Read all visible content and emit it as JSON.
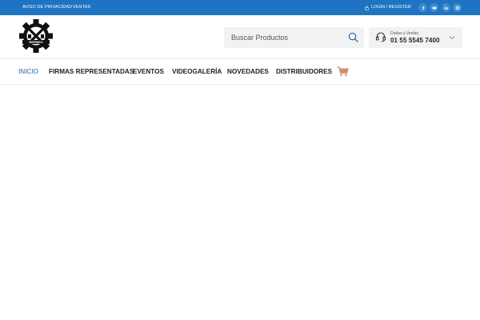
{
  "topbar": {
    "links": [
      "AVISO DE PRIVACIDAD",
      "VENTAS"
    ],
    "login": "LOGIN / REGISTER",
    "social": [
      "facebook-icon",
      "youtube-icon",
      "linkedin-icon",
      "instagram-icon"
    ],
    "colors": {
      "background": "#1e74c2",
      "social_bg": "#3d8ad0"
    }
  },
  "header": {
    "logo_text": "BERMEX",
    "search": {
      "placeholder": "Buscar Productos"
    },
    "contact": {
      "title": "Dudas y Ventas",
      "phone": "01 55 5545 7400"
    }
  },
  "nav": {
    "items": [
      "INICIO",
      "FIRMAS REPRESENTADAS",
      "EVENTOS",
      "VIDEOGALERÍA",
      "NOVEDADES",
      "DISTRIBUIDORES"
    ],
    "active": "INICIO",
    "cart_icon": "cart-icon",
    "colors": {
      "active": "#1f64a6",
      "text": "#222222",
      "cart": "#c98a6b"
    }
  }
}
